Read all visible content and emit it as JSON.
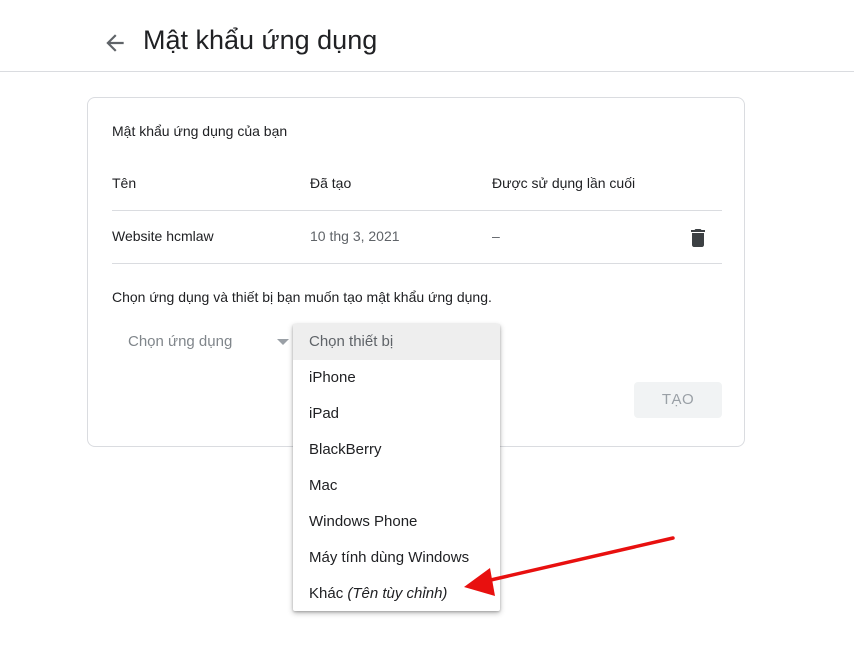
{
  "header": {
    "title": "Mật khẩu ứng dụng",
    "back_icon": "arrow-back-icon"
  },
  "card": {
    "title": "Mật khẩu ứng dụng của bạn",
    "columns": [
      "Tên",
      "Đã tạo",
      "Được sử dụng lần cuối"
    ],
    "rows": [
      {
        "name": "Website hcmlaw",
        "created": "10 thg 3, 2021",
        "last_used": "–",
        "delete_icon": "trash-icon"
      }
    ],
    "instruction": "Chọn ứng dụng và thiết bị bạn muốn tạo mật khẩu ứng dụng.",
    "app_select": {
      "value": "Chọn ứng dụng",
      "icon": "dropdown-arrow-icon"
    },
    "create_button": "TẠO"
  },
  "device_dropdown": {
    "items": [
      {
        "label": "Chọn thiết bị"
      },
      {
        "label": "iPhone"
      },
      {
        "label": "iPad"
      },
      {
        "label": "BlackBerry"
      },
      {
        "label": "Mac"
      },
      {
        "label": "Windows Phone"
      },
      {
        "label": "Máy tính dùng Windows"
      },
      {
        "label": "Khác",
        "hint": "(Tên tùy chỉnh)"
      }
    ]
  },
  "colors": {
    "annotation_arrow": "#e8100f",
    "divider": "#dadce0",
    "highlight": "#eeeeee"
  }
}
